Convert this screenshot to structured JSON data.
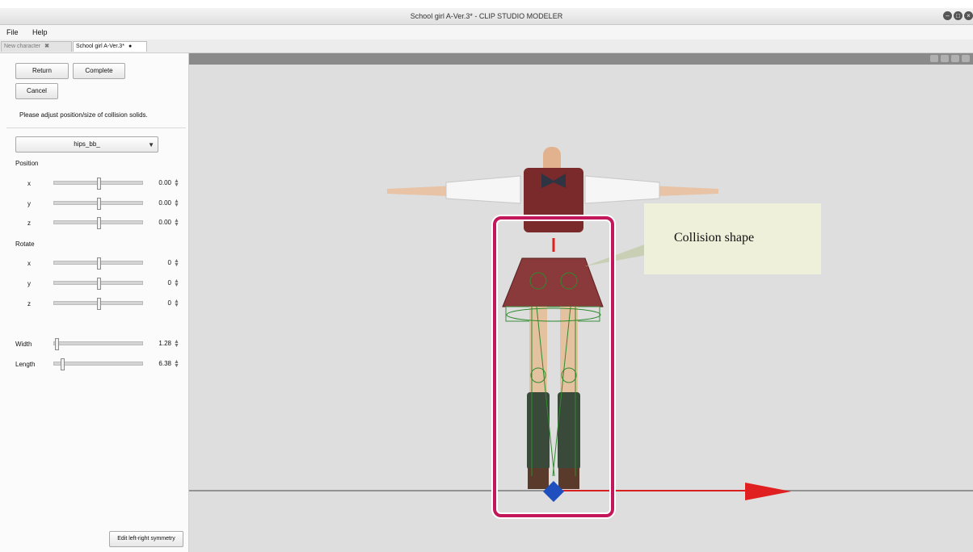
{
  "window": {
    "title": "School girl A-Ver.3* - CLIP STUDIO MODELER"
  },
  "menu": {
    "items": [
      "File",
      "Help"
    ]
  },
  "tabs": [
    {
      "label": "New character",
      "close": "✖"
    },
    {
      "label": "School girl A-Ver.3*",
      "close": "●"
    }
  ],
  "panel": {
    "return_label": "Return",
    "complete_label": "Complete",
    "cancel_label": "Cancel",
    "instruction": "Please adjust position/size of collision solids.",
    "selected_bone": "hips_bb_",
    "position_label": "Position",
    "rotate_label": "Rotate",
    "position": [
      {
        "axis": "x",
        "value": "0.00"
      },
      {
        "axis": "y",
        "value": "0.00"
      },
      {
        "axis": "z",
        "value": "0.00"
      }
    ],
    "rotate": [
      {
        "axis": "x",
        "value": "0"
      },
      {
        "axis": "y",
        "value": "0"
      },
      {
        "axis": "z",
        "value": "0"
      }
    ],
    "width_label": "Width",
    "width_value": "1.28",
    "length_label": "Length",
    "length_value": "6.38",
    "symmetry_label": "Edit left-right symmetry"
  },
  "annotation": {
    "callout": "Collision shape",
    "highlight_color": "#c2185b",
    "callout_bg": "#eef0da"
  },
  "colors": {
    "axis_x": "#e02020",
    "axis_origin": "#1f4fbf",
    "collision_wire": "#2e8b2e"
  },
  "icons": {
    "dropdown": "chevron-down-icon",
    "spin": "spin-arrows-icon",
    "window_controls": [
      "minimize-icon",
      "maximize-icon",
      "close-icon"
    ]
  }
}
